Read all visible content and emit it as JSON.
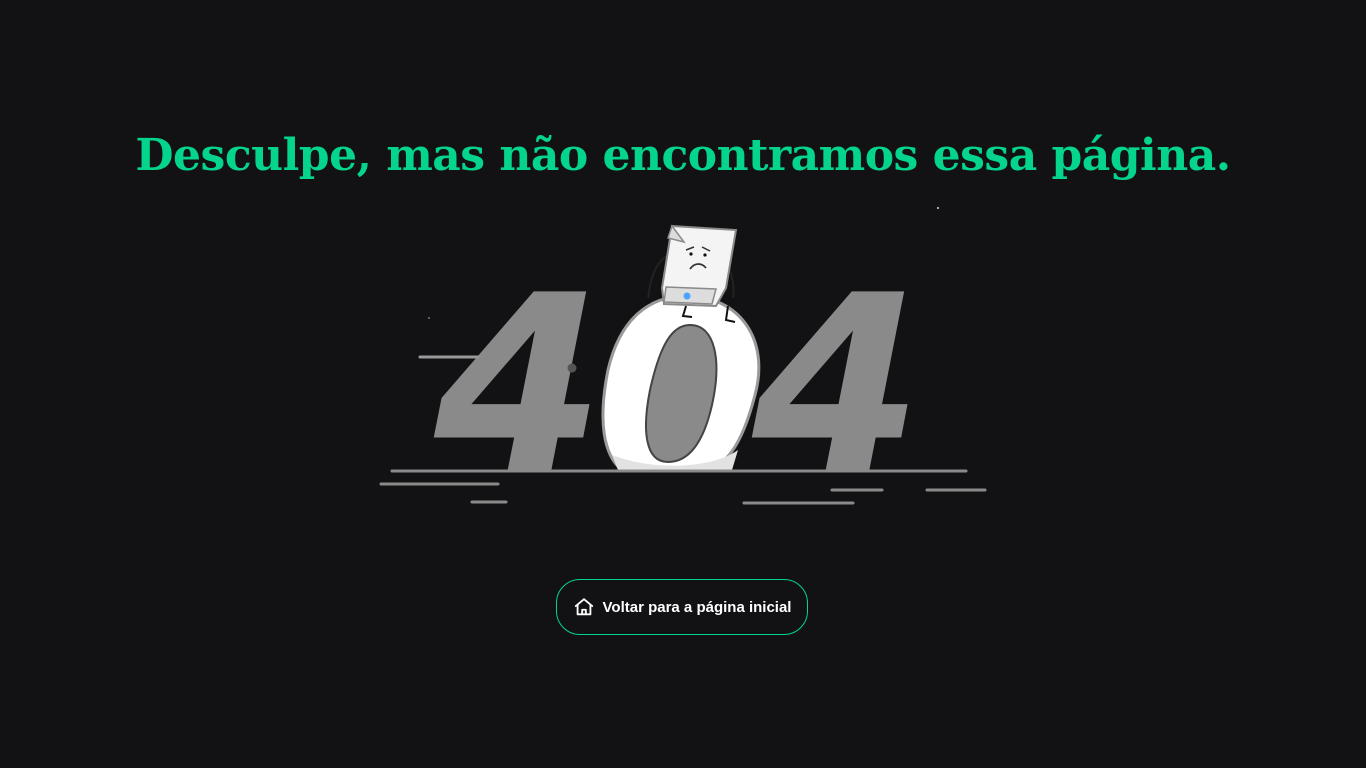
{
  "page": {
    "title": "Desculpe, mas não encontramos essa página."
  },
  "illustration": {
    "digits": [
      "4",
      "0",
      "4"
    ],
    "icon": "404-paper-character-illustration"
  },
  "home_button": {
    "label": "Voltar para a página inicial",
    "icon": "home-icon"
  },
  "colors": {
    "background": "#121214",
    "accent": "#04d48c",
    "digit_gray": "#8a8a8a",
    "digit_white": "#ffffff"
  }
}
